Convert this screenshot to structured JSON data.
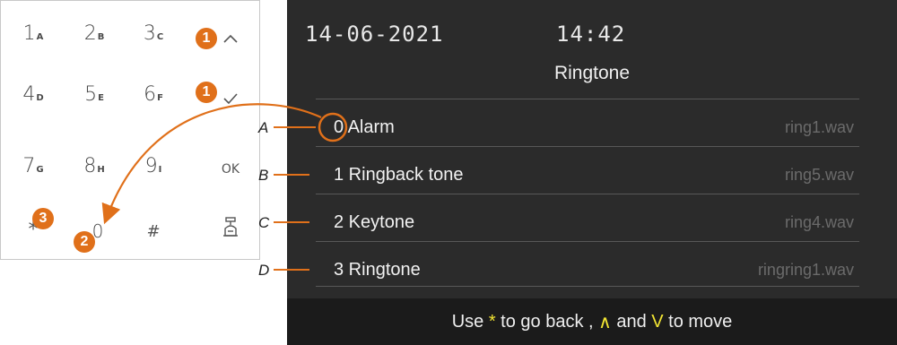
{
  "keypad": {
    "keys": [
      {
        "digit": "1",
        "letter": "A"
      },
      {
        "digit": "2",
        "letter": "B"
      },
      {
        "digit": "3",
        "letter": "C"
      },
      {
        "symbol": "^",
        "icon": "chevron-up-icon"
      },
      {
        "digit": "4",
        "letter": "D"
      },
      {
        "digit": "5",
        "letter": "E"
      },
      {
        "digit": "6",
        "letter": "F"
      },
      {
        "symbol": "✓",
        "icon": "check-icon"
      },
      {
        "digit": "7",
        "letter": "G"
      },
      {
        "digit": "8",
        "letter": "H"
      },
      {
        "digit": "9",
        "letter": "I"
      },
      {
        "symbol": "OK"
      },
      {
        "symbol": "*",
        "icon": "asterisk-icon"
      },
      {
        "symbol": "0"
      },
      {
        "symbol": "#"
      },
      {
        "icon": "door-bell-icon"
      }
    ],
    "badges": [
      "1",
      "1",
      "2",
      "3"
    ]
  },
  "screen": {
    "date": "14-06-2021",
    "time": "14:42",
    "title": "Ringtone",
    "items": [
      {
        "name": "0 Alarm",
        "file": "ring1.wav",
        "marker": "A"
      },
      {
        "name": "1 Ringback tone",
        "file": "ring5.wav",
        "marker": "B"
      },
      {
        "name": "2 Keytone",
        "file": "ring4.wav",
        "marker": "C"
      },
      {
        "name": "3 Ringtone",
        "file": "ringring1.wav",
        "marker": "D"
      }
    ],
    "footer": {
      "pre": "Use ",
      "star": "*",
      "mid": " to go back , ",
      "up": "∧",
      "and": " and ",
      "down": "V",
      "post": " to move"
    }
  },
  "colors": {
    "accent": "#e0701a",
    "highlight": "#f2e533",
    "screen_bg": "#2b2b2b"
  }
}
